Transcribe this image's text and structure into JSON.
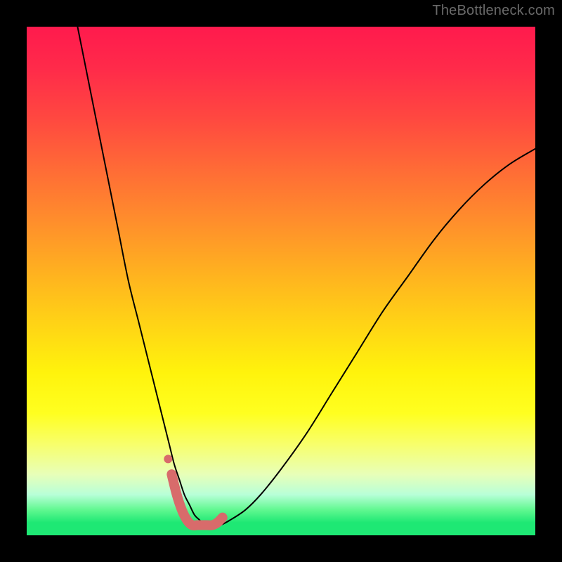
{
  "watermark": {
    "text": "TheBottleneck.com"
  },
  "chart_data": {
    "type": "line",
    "title": "",
    "xlabel": "",
    "ylabel": "",
    "xlim": [
      0,
      100
    ],
    "ylim": [
      0,
      100
    ],
    "grid": false,
    "series": [
      {
        "name": "main-curve",
        "color": "#000000",
        "stroke_width": 2,
        "x": [
          10,
          12,
          14,
          16,
          18,
          20,
          22,
          24,
          26,
          28,
          29,
          30,
          31,
          32,
          33,
          34,
          35,
          36,
          38,
          40,
          43,
          46,
          50,
          55,
          60,
          65,
          70,
          75,
          80,
          85,
          90,
          95,
          100
        ],
        "y": [
          100,
          90,
          80,
          70,
          60,
          50,
          42,
          34,
          26,
          18,
          14,
          11,
          8,
          6,
          4,
          3,
          2,
          2,
          2,
          3,
          5,
          8,
          13,
          20,
          28,
          36,
          44,
          51,
          58,
          64,
          69,
          73,
          76
        ]
      },
      {
        "name": "highlight-band",
        "color": "#d86b6b",
        "stroke_width": 14,
        "x": [
          28.5,
          29.5,
          30.5,
          31.5,
          32.5,
          33.5,
          34.5,
          35.5,
          36.5,
          37.5,
          38.5
        ],
        "y": [
          12,
          8,
          5,
          3,
          2,
          2,
          2,
          2,
          2,
          2.5,
          3.5
        ]
      },
      {
        "name": "highlight-dot",
        "color": "#d86b6b",
        "type": "scatter",
        "radius": 6,
        "x": [
          27.8
        ],
        "y": [
          15
        ]
      }
    ]
  }
}
